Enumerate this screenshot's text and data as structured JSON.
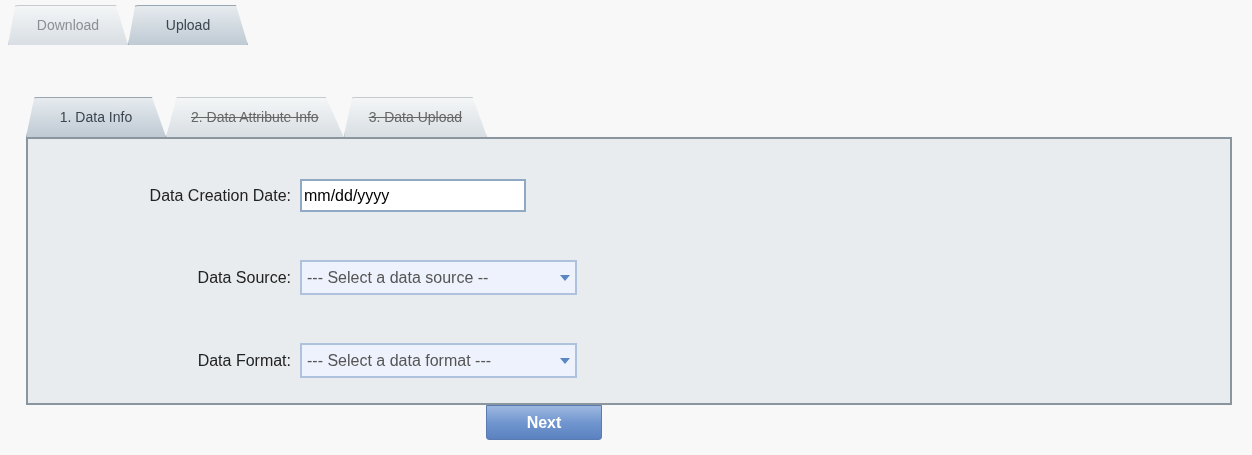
{
  "tabs": [
    {
      "label": "Download",
      "selected": false
    },
    {
      "label": "Upload",
      "selected": true
    }
  ],
  "steps": [
    {
      "label": "1. Data Info",
      "selected": true,
      "disabled": false
    },
    {
      "label": "2. Data Attribute Info",
      "selected": false,
      "disabled": true
    },
    {
      "label": "3. Data Upload",
      "selected": false,
      "disabled": true
    }
  ],
  "fields": [
    {
      "kind": "text",
      "label": "Data Creation Date:",
      "value": "mm/dd/yyyy"
    },
    {
      "kind": "select",
      "label": "Data Source:",
      "value": "--- Select a data source --"
    },
    {
      "kind": "select",
      "label": "Data Format:",
      "value": "--- Select a data format ---"
    }
  ],
  "next_button": "Next"
}
